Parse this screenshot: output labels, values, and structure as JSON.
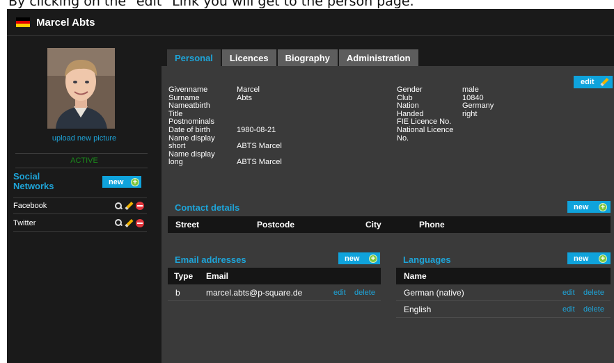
{
  "caption": "By clicking on the \"edit\" Link you will get to the person page.",
  "window": {
    "title": "Marcel Abts"
  },
  "colors": {
    "accent": "#1ea4d8",
    "button": "#0fa3dc",
    "active": "#1b8a1b"
  },
  "sidebar": {
    "upload_label": "upload new picture",
    "status": "ACTIVE",
    "social_title": "Social Networks",
    "new_label": "new",
    "networks": [
      {
        "name": "Facebook",
        "icons": [
          "magnifier-icon",
          "pencil-icon",
          "delete-icon"
        ]
      },
      {
        "name": "Twitter",
        "icons": [
          "magnifier-icon",
          "pencil-icon",
          "delete-icon"
        ]
      }
    ]
  },
  "tabs": [
    "Personal",
    "Licences",
    "Biography",
    "Administration"
  ],
  "personal": {
    "edit_label": "edit",
    "left_fields": [
      {
        "label": "Givenname",
        "value": "Marcel"
      },
      {
        "label": "Surname",
        "value": "Abts"
      },
      {
        "label": "Nameatbirth",
        "value": ""
      },
      {
        "label": "Title",
        "value": ""
      },
      {
        "label": "Postnominals",
        "value": ""
      },
      {
        "label": "Date of birth",
        "value": "1980-08-21"
      },
      {
        "label": "Name display",
        "value": ""
      },
      {
        "label": "short",
        "value": "ABTS Marcel"
      },
      {
        "label": "Name display",
        "value": ""
      },
      {
        "label": "long",
        "value": "ABTS Marcel"
      }
    ],
    "right_fields": [
      {
        "label": "Gender",
        "value": "male"
      },
      {
        "label": "Club",
        "value": "10840"
      },
      {
        "label": "Nation",
        "value": "Germany"
      },
      {
        "label": "Handed",
        "value": "right"
      },
      {
        "label": "FIE Licence No.",
        "value": ""
      },
      {
        "label": "National Licence",
        "value": ""
      },
      {
        "label": "No.",
        "value": ""
      }
    ]
  },
  "contact": {
    "title": "Contact details",
    "new_label": "new",
    "columns": [
      "Street",
      "Postcode",
      "City",
      "Phone"
    ]
  },
  "emails": {
    "title": "Email addresses",
    "new_label": "new",
    "columns": [
      "Type",
      "Email"
    ],
    "rows": [
      {
        "type": "b",
        "email": "marcel.abts@p-square.de",
        "edit": "edit",
        "delete": "delete"
      }
    ]
  },
  "languages": {
    "title": "Languages",
    "new_label": "new",
    "columns": [
      "Name"
    ],
    "rows": [
      {
        "name": "German (native)",
        "edit": "edit",
        "delete": "delete"
      },
      {
        "name": "English",
        "edit": "edit",
        "delete": "delete"
      }
    ]
  }
}
